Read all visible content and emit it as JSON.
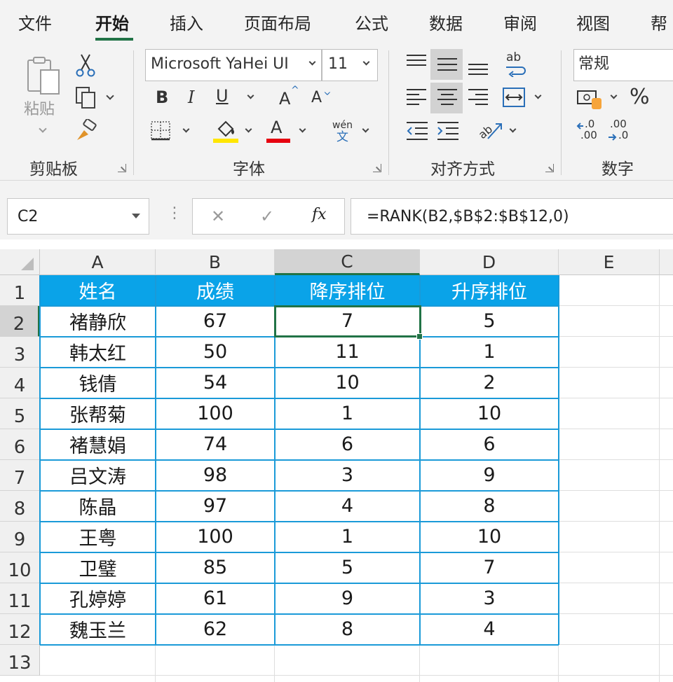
{
  "ribbon_tabs": [
    "文件",
    "开始",
    "插入",
    "页面布局",
    "公式",
    "数据",
    "审阅",
    "视图",
    "帮"
  ],
  "clipboard": {
    "paste_label": "粘贴",
    "group_label": "剪贴板"
  },
  "font": {
    "name": "Microsoft YaHei UI",
    "size": "11",
    "bold": "B",
    "italic": "I",
    "underline": "U",
    "grow": "A",
    "shrink": "A",
    "font_color": "A",
    "phonetic_top": "wén",
    "phonetic_bottom": "文",
    "group_label": "字体",
    "fill_color": "#ffe600",
    "font_color_bar": "#e6000f"
  },
  "alignment": {
    "wrap_icon": "ab",
    "group_label": "对齐方式"
  },
  "number": {
    "format": "常规",
    "percent": "%",
    "inc_decimal_top": ".0",
    "inc_decimal_bottom": ".00",
    "dec_decimal_top": ".00",
    "dec_decimal_bottom": ".0",
    "group_label": "数字"
  },
  "formula_bar": {
    "name_box": "C2",
    "formula": "=RANK(B2,$B$2:$B$12,0)",
    "fx": "fx",
    "cancel": "✕",
    "enter": "✓",
    "dots": "⋮"
  },
  "columns": [
    "A",
    "B",
    "C",
    "D",
    "E"
  ],
  "rows": [
    "1",
    "2",
    "3",
    "4",
    "5",
    "6",
    "7",
    "8",
    "9",
    "10",
    "11",
    "12",
    "13"
  ],
  "table": {
    "headers": [
      "姓名",
      "成绩",
      "降序排位",
      "升序排位"
    ],
    "data": [
      [
        "褚静欣",
        "67",
        "7",
        "5"
      ],
      [
        "韩太红",
        "50",
        "11",
        "1"
      ],
      [
        "钱倩",
        "54",
        "10",
        "2"
      ],
      [
        "张帮菊",
        "100",
        "1",
        "10"
      ],
      [
        "褚慧娟",
        "74",
        "6",
        "6"
      ],
      [
        "吕文涛",
        "98",
        "3",
        "9"
      ],
      [
        "陈晶",
        "97",
        "4",
        "8"
      ],
      [
        "王粤",
        "100",
        "1",
        "10"
      ],
      [
        "卫璧",
        "85",
        "5",
        "7"
      ],
      [
        "孔婷婷",
        "61",
        "9",
        "3"
      ],
      [
        "魏玉兰",
        "62",
        "8",
        "4"
      ]
    ]
  },
  "colors": {
    "accent": "#217346",
    "header_fill": "#0aa3e8",
    "table_border": "#1a9ad8"
  }
}
